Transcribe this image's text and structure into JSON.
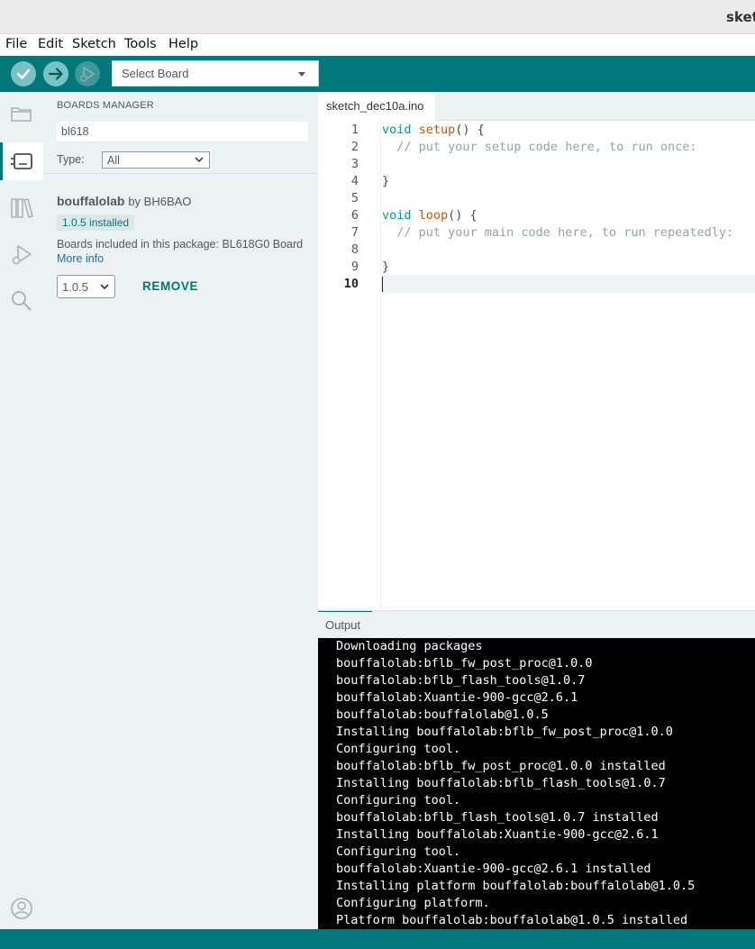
{
  "window": {
    "title": "sketch"
  },
  "menu": [
    "File",
    "Edit",
    "Sketch",
    "Tools",
    "Help"
  ],
  "toolbar": {
    "verify_icon": "check-icon",
    "upload_icon": "arrow-right-icon",
    "debug_icon": "debug-icon",
    "board_select": "Select Board"
  },
  "sidebar_icons": [
    "folder-icon",
    "boards-manager-icon",
    "library-icon",
    "debug-icon",
    "search-icon",
    "account-icon"
  ],
  "boards_manager": {
    "title": "BOARDS MANAGER",
    "search_value": "bl618",
    "type_label": "Type:",
    "type_value": "All",
    "package": {
      "name": "bouffalolab",
      "by": "by BH6BAO",
      "installed_badge": "1.0.5 installed",
      "boards_text": "Boards included in this package: BL618G0 Board",
      "more_info": "More info",
      "version": "1.0.5",
      "remove": "REMOVE"
    }
  },
  "editor": {
    "tab": "sketch_dec10a.ino",
    "line_numbers": [
      "1",
      "2",
      "3",
      "4",
      "5",
      "6",
      "7",
      "8",
      "9",
      "10"
    ],
    "lines": [
      {
        "kw": "void",
        "fn": "setup",
        "rest": "() {"
      },
      {
        "comment": "  // put your setup code here, to run once:"
      },
      {
        "text": ""
      },
      {
        "text": "}"
      },
      {
        "text": ""
      },
      {
        "kw": "void",
        "fn": "loop",
        "rest": "() {"
      },
      {
        "comment": "  // put your main code here, to run repeatedly:"
      },
      {
        "text": ""
      },
      {
        "text": "}"
      },
      {
        "text": ""
      }
    ],
    "current_line": "10"
  },
  "output": {
    "label": "Output",
    "lines": [
      "Downloading packages",
      "bouffalolab:bflb_fw_post_proc@1.0.0",
      "bouffalolab:bflb_flash_tools@1.0.7",
      "bouffalolab:Xuantie-900-gcc@2.6.1",
      "bouffalolab:bouffalolab@1.0.5",
      "Installing bouffalolab:bflb_fw_post_proc@1.0.0",
      "Configuring tool.",
      "bouffalolab:bflb_fw_post_proc@1.0.0 installed",
      "Installing bouffalolab:bflb_flash_tools@1.0.7",
      "Configuring tool.",
      "bouffalolab:bflb_flash_tools@1.0.7 installed",
      "Installing bouffalolab:Xuantie-900-gcc@2.6.1",
      "Configuring tool.",
      "bouffalolab:Xuantie-900-gcc@2.6.1 installed",
      "Installing platform bouffalolab:bouffalolab@1.0.5",
      "Configuring platform.",
      "Platform bouffalolab:bouffalolab@1.0.5 installed"
    ]
  },
  "colors": {
    "accent": "#00787a",
    "sidebar_bg": "#ecf1f1",
    "output_bg": "#000000"
  }
}
